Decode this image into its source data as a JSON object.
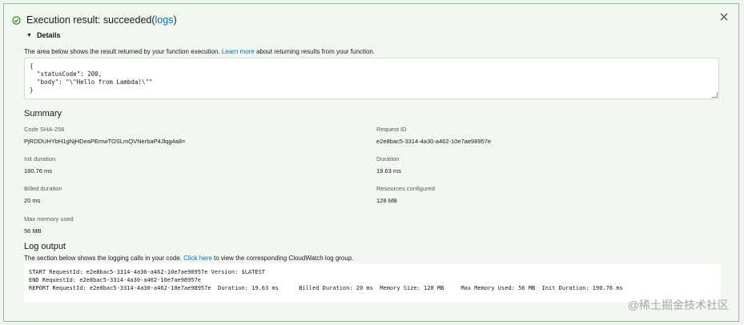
{
  "header": {
    "title": "Execution result: succeeded",
    "paren_open": " (",
    "logs_link": "logs",
    "paren_close": ")"
  },
  "details": {
    "label": "Details",
    "description_before": "The area below shows the result returned by your function execution. ",
    "description_link": "Learn more",
    "description_after": " about returning results from your function.",
    "result_code": "{\n  \"statusCode\": 200,\n  \"body\": \"\\\"Hello from Lambda!\\\"\"\n}"
  },
  "summary": {
    "title": "Summary",
    "code_sha_label": "Code SHA-256",
    "code_sha_value": "PjRDDUHYbH1gNjHDeaPEmwTOSLmQVNerbaP4Jlqg4a8=",
    "request_id_label": "Request ID",
    "request_id_value": "e2e8bac5-3314-4a30-a462-10e7ae98957e",
    "init_duration_label": "Init duration",
    "init_duration_value": "190.76 ms",
    "duration_label": "Duration",
    "duration_value": "19.63 ms",
    "billed_duration_label": "Billed duration",
    "billed_duration_value": "20 ms",
    "resources_label": "Resources configured",
    "resources_value": "128 MB",
    "max_memory_label": "Max memory used",
    "max_memory_value": "56 MB"
  },
  "log_output": {
    "title": "Log output",
    "description_before": "The section below shows the logging calls in your code. ",
    "description_link": "Click here",
    "description_after": " to view the corresponding CloudWatch log group.",
    "lines": "START RequestId: e2e8bac5-3314-4a30-a462-10e7ae98957e Version: $LATEST\nEND RequestId: e2e8bac5-3314-4a30-a462-10e7ae98957e\nREPORT RequestId: e2e8bac5-3314-4a30-a462-10e7ae98957e  Duration: 19.63 ms      Billed Duration: 20 ms  Memory Size: 128 MB     Max Memory Used: 56 MB  Init Duration: 190.76 ms"
  },
  "watermark": "@稀土掘金技术社区",
  "colors": {
    "success_green": "#1d8102",
    "link_blue": "#0073bb",
    "panel_background": "#f2f8f0",
    "panel_border": "#8bc28a"
  },
  "icons": {
    "status": "check-circle-icon",
    "close": "close-icon",
    "expand": "caret-down-icon"
  }
}
